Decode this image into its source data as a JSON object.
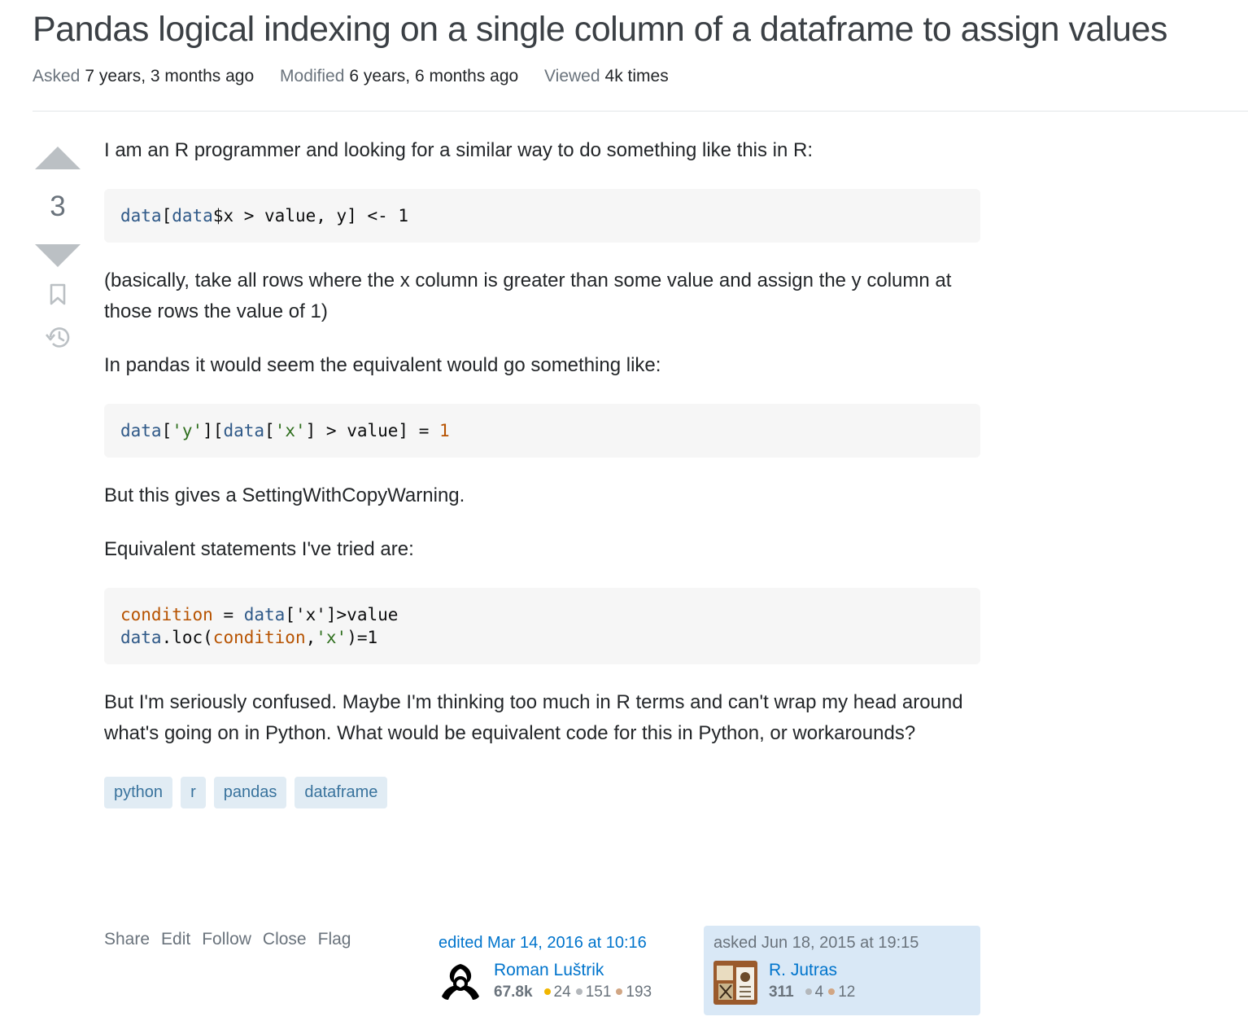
{
  "question": {
    "title": "Pandas logical indexing on a single column of a dataframe to assign values",
    "meta": [
      {
        "label": "Asked",
        "value": "7 years, 3 months ago"
      },
      {
        "label": "Modified",
        "value": "6 years, 6 months ago"
      },
      {
        "label": "Viewed",
        "value": "4k times"
      }
    ],
    "score": "3",
    "paragraphs": {
      "p1": "I am an R programmer and looking for a similar way to do something like this in R:",
      "p2": "(basically, take all rows where the x column is greater than some value and assign the y column at those rows the value of 1)",
      "p3": "In pandas it would seem the equivalent would go something like:",
      "p4": "But this gives a SettingWithCopyWarning.",
      "p5": "Equivalent statements I've tried are:",
      "p6": "But I'm seriously confused. Maybe I'm thinking too much in R terms and can't wrap my head around what's going on in Python. What would be equivalent code for this in Python, or workarounds?"
    },
    "code": {
      "c1": [
        {
          "t": "data",
          "c": "kw"
        },
        {
          "t": "["
        },
        {
          "t": "data",
          "c": "kw"
        },
        {
          "t": "$x > value, y] <- 1"
        }
      ],
      "c2": [
        {
          "t": "data",
          "c": "kw"
        },
        {
          "t": "["
        },
        {
          "t": "'y'",
          "c": "st"
        },
        {
          "t": "]["
        },
        {
          "t": "data",
          "c": "kw"
        },
        {
          "t": "["
        },
        {
          "t": "'x'",
          "c": "st"
        },
        {
          "t": "] > value] = "
        },
        {
          "t": "1",
          "c": "nm"
        }
      ],
      "c3": [
        {
          "t": "condition",
          "c": "vr"
        },
        {
          "t": " = "
        },
        {
          "t": "data",
          "c": "kw"
        },
        {
          "t": "['x']>value\n"
        },
        {
          "t": "data",
          "c": "kw"
        },
        {
          "t": ".loc("
        },
        {
          "t": "condition",
          "c": "vr"
        },
        {
          "t": ","
        },
        {
          "t": "'x'",
          "c": "st"
        },
        {
          "t": ")=1"
        }
      ]
    },
    "tags": [
      "python",
      "r",
      "pandas",
      "dataframe"
    ],
    "menu": {
      "share": "Share",
      "edit": "Edit",
      "follow": "Follow",
      "close": "Close",
      "flag": "Flag"
    },
    "editor": {
      "action": "edited Mar 14, 2016 at 10:16",
      "name": "Roman Luštrik",
      "rep": "67.8k",
      "gold": "24",
      "silver": "151",
      "bronze": "193"
    },
    "owner": {
      "action": "asked Jun 18, 2015 at 19:15",
      "name": "R. Jutras",
      "rep": "311",
      "silver": "4",
      "bronze": "12"
    },
    "icons": [
      "upvote-icon",
      "downvote-icon",
      "bookmark-icon",
      "history-icon"
    ],
    "colors": {
      "link": "#0074cc",
      "tag_bg": "#e1ecf4",
      "tag_fg": "#39739d",
      "owner_bg": "#d9e8f6",
      "gold": "#f1b600",
      "silver": "#b4b8bc",
      "bronze": "#d1a684"
    }
  }
}
